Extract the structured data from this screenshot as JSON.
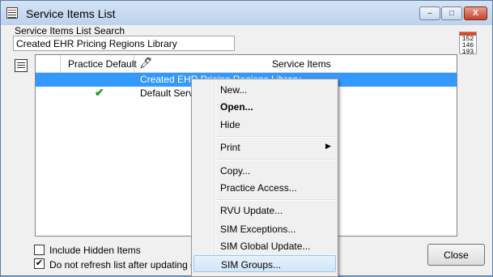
{
  "window": {
    "title": "Service Items List",
    "controls": {
      "minimize": "–",
      "maximize": "□",
      "close": "X"
    }
  },
  "search": {
    "label": "Service Items List Search",
    "value": "Created EHR Pricing Regions Library"
  },
  "calendar_icon": {
    "lines": [
      "152",
      "146",
      "193"
    ]
  },
  "grid": {
    "columns": [
      "Practice Default",
      "Service Items"
    ],
    "rows": [
      {
        "practice_default": false,
        "service_item": "Created EHR Pricing Regions Library",
        "selected": true
      },
      {
        "practice_default": true,
        "service_item": "Default Servi",
        "selected": false
      }
    ]
  },
  "options": {
    "include_hidden": {
      "label": "Include Hidden Items",
      "checked": false
    },
    "no_refresh": {
      "label": "Do not refresh list after updating data",
      "checked": true
    }
  },
  "close_button": "Close",
  "context_menu": {
    "groups": [
      [
        {
          "label": "New...",
          "bold": false
        },
        {
          "label": "Open...",
          "bold": true
        },
        {
          "label": "Hide",
          "bold": false
        }
      ],
      [
        {
          "label": "Print",
          "bold": false,
          "submenu": true
        }
      ],
      [
        {
          "label": "Copy...",
          "bold": false
        },
        {
          "label": "Practice Access...",
          "bold": false
        }
      ],
      [
        {
          "label": "RVU Update...",
          "bold": false
        },
        {
          "label": "SIM Exceptions...",
          "bold": false
        },
        {
          "label": "SIM Global Update...",
          "bold": false
        },
        {
          "label": "SIM Groups...",
          "bold": false,
          "highlighted": true
        }
      ]
    ]
  },
  "colors": {
    "selection": "#3399ff",
    "checkmark": "#1c9b1c",
    "menu_highlight_border": "#9cc5ee"
  }
}
